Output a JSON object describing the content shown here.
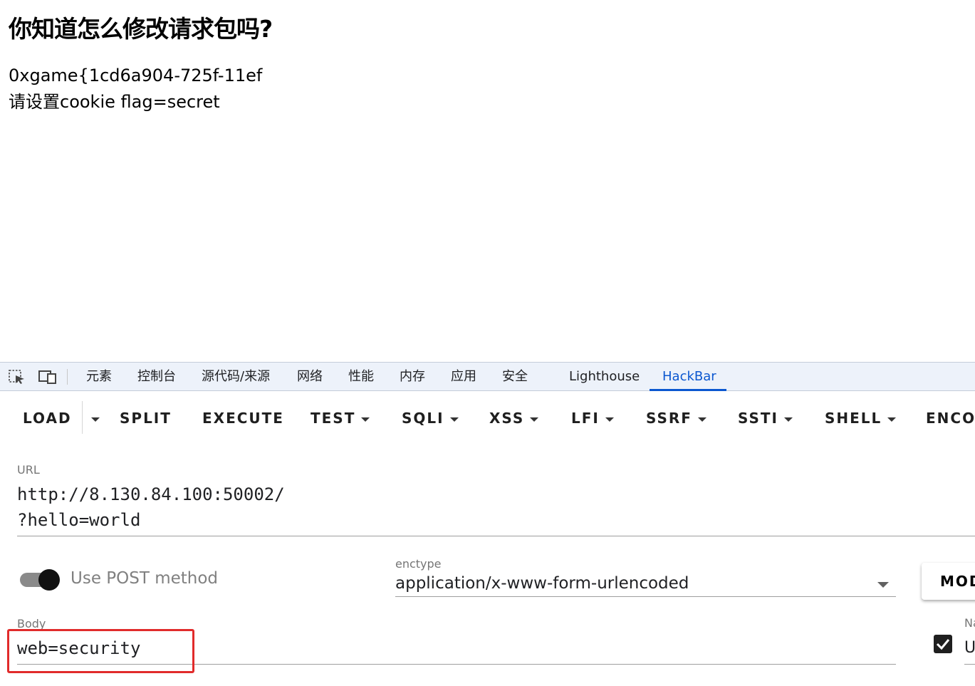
{
  "page": {
    "heading": "你知道怎么修改请求包吗?",
    "flag_text": "0xgame{1cd6a904-725f-11ef",
    "hint_text": "请设置cookie flag=secret"
  },
  "devtools": {
    "tabs": [
      {
        "label": "元素"
      },
      {
        "label": "控制台"
      },
      {
        "label": "源代码/来源"
      },
      {
        "label": "网络"
      },
      {
        "label": "性能"
      },
      {
        "label": "内存"
      },
      {
        "label": "应用"
      },
      {
        "label": "安全"
      },
      {
        "label": "Lighthouse"
      },
      {
        "label": "HackBar",
        "active": true
      }
    ],
    "icons": [
      "inspect-element-icon",
      "device-toolbar-icon"
    ],
    "accent_color": "#0b57d0"
  },
  "hackbar": {
    "toolbar": {
      "load": "LOAD",
      "split": "SPLIT",
      "execute": "EXECUTE",
      "test": "TEST",
      "sqli": "SQLI",
      "xss": "XSS",
      "lfi": "LFI",
      "ssrf": "SSRF",
      "ssti": "SSTI",
      "shell": "SHELL",
      "encode": "ENCOD"
    },
    "url": {
      "label": "URL",
      "line1": "http://8.130.84.100:50002/",
      "line2": "?hello=world"
    },
    "post": {
      "label": "Use POST method",
      "enabled": true
    },
    "enctype": {
      "label": "enctype",
      "value": "application/x-www-form-urlencoded"
    },
    "modify_button": "MOD",
    "body": {
      "label": "Body",
      "value": "web=security"
    },
    "side": {
      "name_label": "Na",
      "field_value": "U",
      "checked": true
    },
    "highlight_color": "#e12b2b"
  }
}
